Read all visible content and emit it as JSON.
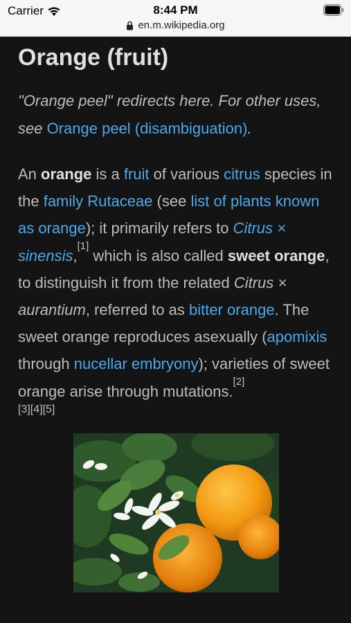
{
  "status_bar": {
    "carrier": "Carrier",
    "time": "8:44 PM",
    "url": "en.m.wikipedia.org"
  },
  "article": {
    "title": "Orange (fruit)",
    "hatnote_prefix": "\"Orange peel\" redirects here. For other uses, see ",
    "hatnote_link": "Orange peel (disambiguation)",
    "hatnote_suffix": ".",
    "lead": {
      "t1": "An ",
      "b1": "orange",
      "t2": " is a ",
      "l_fruit": "fruit",
      "t3": " of various ",
      "l_citrus": "citrus",
      "t4": " species in the ",
      "l_family": "family",
      "t5": " ",
      "l_rutaceae": "Rutaceae",
      "t6": " (see ",
      "l_list": "list of plants known as orange",
      "t7": "); it primarily refers to ",
      "l_sinensis": "Citrus × sinensis",
      "t8": ",",
      "ref1": "[1]",
      "t9": " which is also called ",
      "b2": "sweet orange",
      "t10": ", to distinguish it from the related ",
      "i_aurantium": "Citrus × aurantium",
      "t11": ", referred to as ",
      "l_bitter": "bitter orange",
      "t12": ". The sweet orange reproduces asexually (",
      "l_apomixis": "apomixis",
      "t13": " through ",
      "l_nucellar": "nucellar embryony",
      "t14": "); varieties of sweet orange arise through mutations.",
      "ref2": "[2]",
      "refs": "[3][4][5]"
    }
  },
  "colors": {
    "link": "#4ba9ee",
    "background": "#141414",
    "text": "#bdbdbd"
  },
  "icons": [
    "wifi-icon",
    "lock-icon",
    "battery-icon"
  ]
}
